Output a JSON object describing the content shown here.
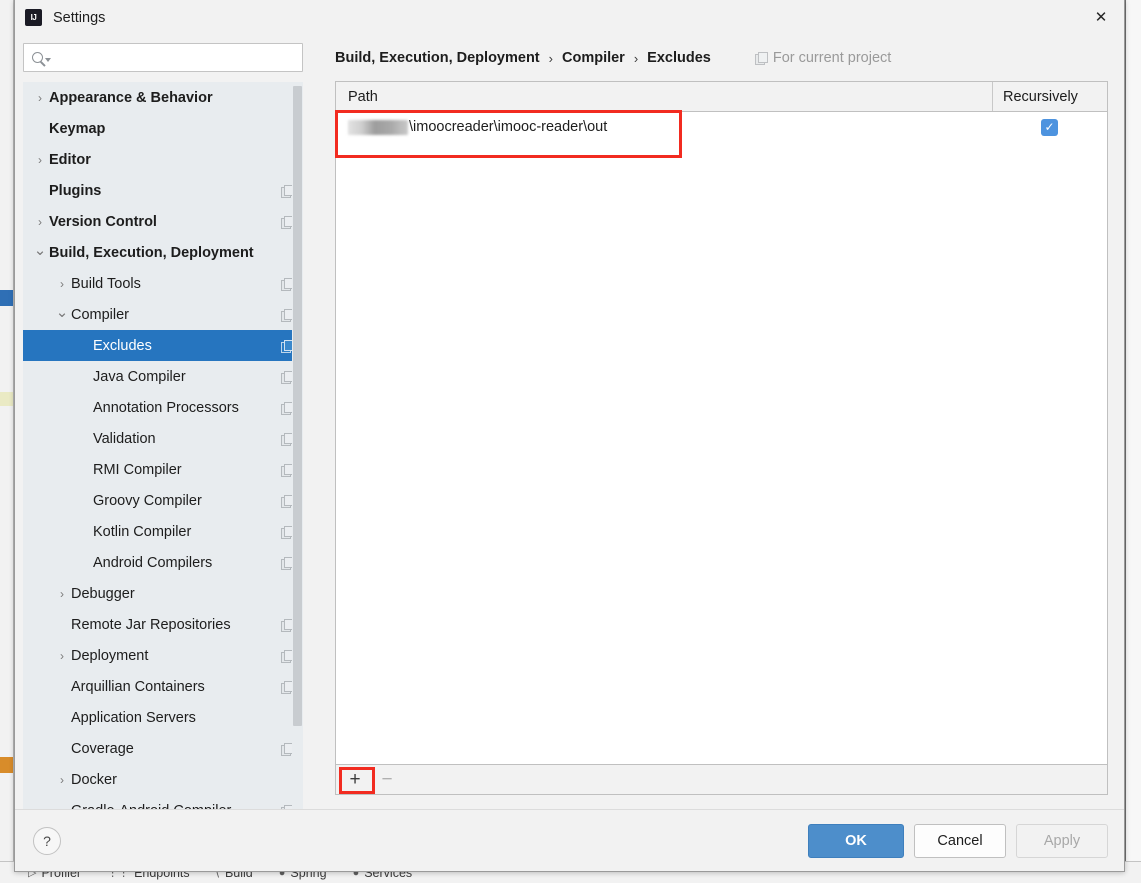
{
  "window": {
    "title": "Settings",
    "logo_icon": "intellij-idea-logo",
    "close_icon": "close-icon"
  },
  "search": {
    "value": "",
    "placeholder": "",
    "icon": "search-icon",
    "dropdown_icon": "chevron-down-icon"
  },
  "sidebar": {
    "items": [
      {
        "label": "Appearance & Behavior",
        "indent": 0,
        "arrow": "chevron-right",
        "bold": true,
        "selected": false,
        "copy_icon": false
      },
      {
        "label": "Keymap",
        "indent": 0,
        "arrow": "none",
        "bold": true,
        "selected": false,
        "copy_icon": false
      },
      {
        "label": "Editor",
        "indent": 0,
        "arrow": "chevron-right",
        "bold": true,
        "selected": false,
        "copy_icon": false
      },
      {
        "label": "Plugins",
        "indent": 0,
        "arrow": "none",
        "bold": true,
        "selected": false,
        "copy_icon": true
      },
      {
        "label": "Version Control",
        "indent": 0,
        "arrow": "chevron-right",
        "bold": true,
        "selected": false,
        "copy_icon": true
      },
      {
        "label": "Build, Execution, Deployment",
        "indent": 0,
        "arrow": "chevron-down",
        "bold": true,
        "selected": false,
        "copy_icon": false
      },
      {
        "label": "Build Tools",
        "indent": 1,
        "arrow": "chevron-right",
        "bold": false,
        "selected": false,
        "copy_icon": true
      },
      {
        "label": "Compiler",
        "indent": 1,
        "arrow": "chevron-down",
        "bold": false,
        "selected": false,
        "copy_icon": true
      },
      {
        "label": "Excludes",
        "indent": 2,
        "arrow": "none",
        "bold": false,
        "selected": true,
        "copy_icon": true
      },
      {
        "label": "Java Compiler",
        "indent": 2,
        "arrow": "none",
        "bold": false,
        "selected": false,
        "copy_icon": true
      },
      {
        "label": "Annotation Processors",
        "indent": 2,
        "arrow": "none",
        "bold": false,
        "selected": false,
        "copy_icon": true
      },
      {
        "label": "Validation",
        "indent": 2,
        "arrow": "none",
        "bold": false,
        "selected": false,
        "copy_icon": true
      },
      {
        "label": "RMI Compiler",
        "indent": 2,
        "arrow": "none",
        "bold": false,
        "selected": false,
        "copy_icon": true
      },
      {
        "label": "Groovy Compiler",
        "indent": 2,
        "arrow": "none",
        "bold": false,
        "selected": false,
        "copy_icon": true
      },
      {
        "label": "Kotlin Compiler",
        "indent": 2,
        "arrow": "none",
        "bold": false,
        "selected": false,
        "copy_icon": true
      },
      {
        "label": "Android Compilers",
        "indent": 2,
        "arrow": "none",
        "bold": false,
        "selected": false,
        "copy_icon": true
      },
      {
        "label": "Debugger",
        "indent": 1,
        "arrow": "chevron-right",
        "bold": false,
        "selected": false,
        "copy_icon": false
      },
      {
        "label": "Remote Jar Repositories",
        "indent": 1,
        "arrow": "none",
        "bold": false,
        "selected": false,
        "copy_icon": true
      },
      {
        "label": "Deployment",
        "indent": 1,
        "arrow": "chevron-right",
        "bold": false,
        "selected": false,
        "copy_icon": true
      },
      {
        "label": "Arquillian Containers",
        "indent": 1,
        "arrow": "none",
        "bold": false,
        "selected": false,
        "copy_icon": true
      },
      {
        "label": "Application Servers",
        "indent": 1,
        "arrow": "none",
        "bold": false,
        "selected": false,
        "copy_icon": false
      },
      {
        "label": "Coverage",
        "indent": 1,
        "arrow": "none",
        "bold": false,
        "selected": false,
        "copy_icon": true
      },
      {
        "label": "Docker",
        "indent": 1,
        "arrow": "chevron-right",
        "bold": false,
        "selected": false,
        "copy_icon": false
      },
      {
        "label": "Gradle-Android Compiler",
        "indent": 1,
        "arrow": "none",
        "bold": false,
        "selected": false,
        "copy_icon": true
      }
    ]
  },
  "main": {
    "breadcrumb": [
      "Build, Execution, Deployment",
      "Compiler",
      "Excludes"
    ],
    "breadcrumb_separator": "›",
    "scope_label": "For current project",
    "scope_icon": "project-scope-icon",
    "table": {
      "columns": [
        "Path",
        "Recursively"
      ],
      "rows": [
        {
          "path_redacted": true,
          "path": "\\imoocreader\\imooc-reader\\out",
          "recursively": true
        }
      ]
    },
    "toolbar": {
      "add_label": "+",
      "remove_label": "−",
      "add_icon": "plus-icon",
      "remove_icon": "minus-icon"
    }
  },
  "footer": {
    "help_label": "?",
    "help_icon": "help-icon",
    "ok_label": "OK",
    "cancel_label": "Cancel",
    "apply_label": "Apply"
  },
  "ide_toolbar": {
    "items": [
      {
        "label": "Profiler",
        "icon": "profiler-icon"
      },
      {
        "label": "Endpoints",
        "icon": "endpoints-icon"
      },
      {
        "label": "Build",
        "icon": "build-icon"
      },
      {
        "label": "Spring",
        "icon": "spring-icon"
      },
      {
        "label": "Services",
        "icon": "services-icon"
      }
    ]
  },
  "colors": {
    "accent_selection": "#2675bf",
    "primary_button": "#4d8ecb",
    "highlight_box": "#f22b20",
    "checkbox": "#4d93df",
    "sidebar_bg": "#e8ecef"
  }
}
